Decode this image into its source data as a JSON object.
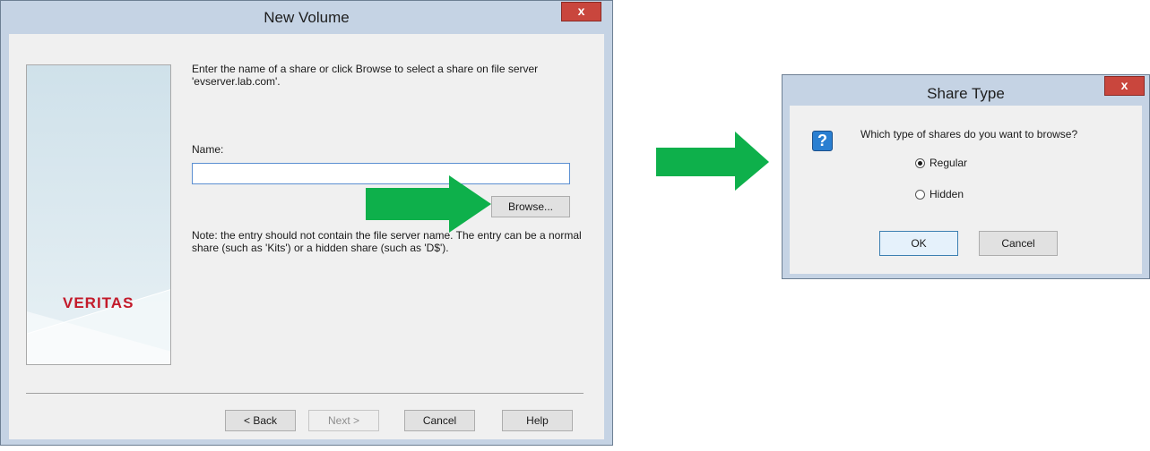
{
  "new_volume": {
    "title": "New Volume",
    "close_glyph": "x",
    "logo": "VERITAS",
    "instruction": "Enter the name of a share or click Browse to select a share on file server 'evserver.lab.com'.",
    "name_label": "Name:",
    "name_value": "",
    "browse_label": "Browse...",
    "note": "Note: the entry should not contain the file server name. The entry can be a normal share (such as 'Kits') or a hidden share (such as 'D$').",
    "buttons": {
      "back": "< Back",
      "next": "Next >",
      "cancel": "Cancel",
      "help": "Help"
    }
  },
  "share_type": {
    "title": "Share Type",
    "close_glyph": "x",
    "icon": "question-icon",
    "icon_glyph": "?",
    "question": "Which type of shares do you want to browse?",
    "options": [
      {
        "label": "Regular",
        "selected": true
      },
      {
        "label": "Hidden",
        "selected": false
      }
    ],
    "ok_label": "OK",
    "cancel_label": "Cancel"
  },
  "colors": {
    "arrow_green": "#0eb04b",
    "title_bar": "#c5d3e4",
    "close_red": "#c9463d",
    "logo_red": "#c31a2a"
  }
}
